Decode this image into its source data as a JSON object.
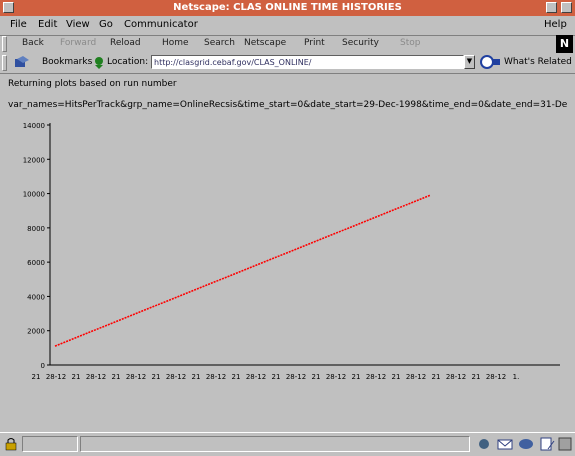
{
  "window": {
    "title": "Netscape: CLAS ONLINE TIME HISTORIES"
  },
  "menu": {
    "file": "File",
    "edit": "Edit",
    "view": "View",
    "go": "Go",
    "communicator": "Communicator",
    "help": "Help"
  },
  "toolbar": {
    "back": "Back",
    "forward": "Forward",
    "reload": "Reload",
    "home": "Home",
    "search": "Search",
    "netscape": "Netscape",
    "print": "Print",
    "security": "Security",
    "stop": "Stop"
  },
  "location": {
    "bookmarks": "Bookmarks",
    "label": "Location:",
    "url": "http://clasgrid.cebaf.gov/CLAS_ONLINE/",
    "whats_related": "What's Related"
  },
  "page": {
    "heading": "Returning plots based on run number",
    "query": "var_names=HitsPerTrack&grp_name=OnlineRecsis&time_start=0&date_start=29-Dec-1998&time_end=0&date_end=31-De"
  },
  "chart_data": {
    "type": "line",
    "title": "",
    "xlabel": "",
    "ylabel": "",
    "ylim": [
      0,
      14000
    ],
    "yticks": [
      0,
      2000,
      4000,
      6000,
      8000,
      10000,
      12000,
      14000
    ],
    "ytick_labels": [
      "0",
      "2000",
      "4000",
      "6000",
      "8000",
      "10000",
      "12000",
      "14000"
    ],
    "xtick_labels": [
      "21",
      "28-12",
      "21",
      "28-12",
      "21",
      "28-12",
      "21",
      "28-12",
      "21",
      "28-12",
      "21",
      "28-12",
      "21",
      "28-12",
      "21",
      "28-12",
      "21",
      "28-12",
      "21",
      "28-12",
      "21",
      "28-12",
      "21",
      "28-12",
      "1."
    ],
    "series": [
      {
        "color": "#ff0000",
        "x": [
          0,
          1
        ],
        "y": [
          1100,
          9900
        ]
      }
    ]
  },
  "colors": {
    "title_bar": "#d06040",
    "chart_line": "#ff0000"
  }
}
